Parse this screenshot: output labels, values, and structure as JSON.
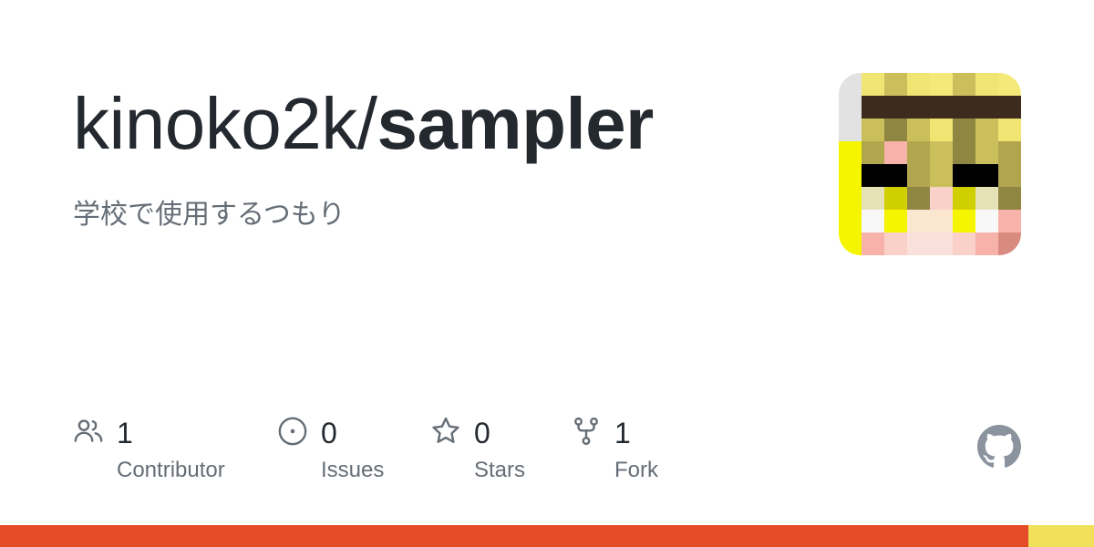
{
  "repo": {
    "owner_prefix": "kinoko2k/",
    "name": "sampler",
    "description": "学校で使用するつもり"
  },
  "stats": {
    "contributors": {
      "count": "1",
      "label": "Contributor",
      "icon": "people-icon"
    },
    "issues": {
      "count": "0",
      "label": "Issues",
      "icon": "issue-opened-icon"
    },
    "stars": {
      "count": "0",
      "label": "Stars",
      "icon": "star-icon"
    },
    "forks": {
      "count": "1",
      "label": "Fork",
      "icon": "repo-forked-icon"
    }
  },
  "brand": {
    "icon": "github-mark-icon",
    "color": "#8b949e"
  },
  "language_bar": {
    "colors": [
      "#e34c26",
      "#f1e05a"
    ],
    "fractions": [
      0.94,
      0.06
    ]
  },
  "colors": {
    "text_primary": "#24292f",
    "text_secondary": "#656d76",
    "icon": "#656d76"
  }
}
